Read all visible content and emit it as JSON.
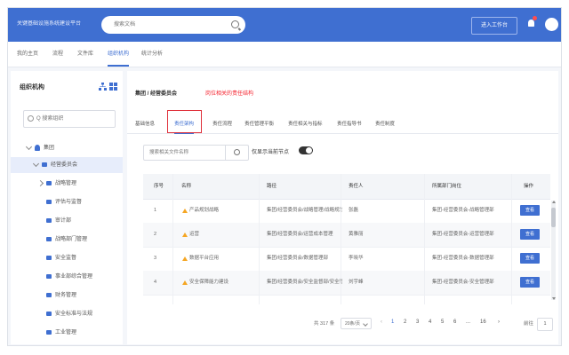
{
  "header": {
    "app_title": "关键基础设施系统建设平台",
    "search_placeholder": "搜索文档",
    "enter_workspace": "进入工作台",
    "colors": {
      "primary": "#3f6fd1",
      "badge": "#ff4d4f"
    }
  },
  "nav": {
    "items": [
      {
        "label": "我的主页"
      },
      {
        "label": "流程"
      },
      {
        "label": "文件库"
      },
      {
        "label": "组织机构"
      },
      {
        "label": "统计分析"
      }
    ],
    "active_index": 3
  },
  "sidebar": {
    "title": "组织机构",
    "search_placeholder": "Q 搜索组织",
    "tree": [
      {
        "label": "集团"
      },
      {
        "label": "经营委员会"
      },
      {
        "label": "战略管理"
      },
      {
        "label": "评估与监督"
      },
      {
        "label": "审计部"
      },
      {
        "label": "战略部门管理"
      },
      {
        "label": "安全监督"
      },
      {
        "label": "事业部综合管理"
      },
      {
        "label": "财务管理"
      },
      {
        "label": "安全标准与法规"
      },
      {
        "label": "工业管理"
      }
    ]
  },
  "main": {
    "breadcrumb": "集团 / 经营委员会",
    "annotation": "岗位相关的责任结构",
    "tabs": [
      {
        "label": "基础信息"
      },
      {
        "label": "责任架构"
      },
      {
        "label": "责任流程"
      },
      {
        "label": "责任管理平衡"
      },
      {
        "label": "责任相关与指标"
      },
      {
        "label": "责任指导书"
      },
      {
        "label": "责任制度"
      }
    ],
    "active_tab": 1,
    "doc_search_placeholder": "搜索相关文件名称",
    "only_current_label": "仅显示当前节点",
    "table": {
      "headers": [
        "序号",
        "名称",
        "路径",
        "责任人",
        "所属部门岗位",
        "操作"
      ],
      "rows": [
        {
          "no": "1",
          "name": "产品规划战略",
          "path": "集团/经营委员会/战略管理/战略规划",
          "owner": "张磊",
          "dept": "集团-经营委员会-战略管理部",
          "action": "查看"
        },
        {
          "no": "2",
          "name": "运营",
          "path": "集团/经营委员会/运营成本管理",
          "owner": "黄雅丽",
          "dept": "集团-经营委员会-运营管理部",
          "action": "查看"
        },
        {
          "no": "3",
          "name": "数据平台应用",
          "path": "集团/经营委员会/数据管理部",
          "owner": "李晓华",
          "dept": "集团-经营委员会-数据管理部",
          "action": "查看"
        },
        {
          "no": "4",
          "name": "安全保障能力建设",
          "path": "集团/经营委员会/安全监督部/安全管理",
          "owner": "刘宇峰",
          "dept": "集团-经营委员会-安全管理部",
          "action": "查看"
        }
      ]
    },
    "pager": {
      "total": "共 317 条",
      "page_size": "20条/页",
      "pages": [
        "1",
        "2",
        "3",
        "4",
        "5",
        "6",
        "...",
        "16"
      ],
      "active_page": "1",
      "goto_label": "前往",
      "goto_value": "1",
      "unit": "页"
    }
  }
}
